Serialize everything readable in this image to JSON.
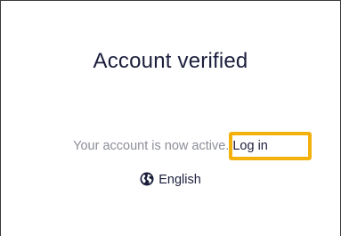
{
  "card": {
    "title": "Account verified",
    "message": "Your account is now active.",
    "login_link": "Log in",
    "language": {
      "label": "English",
      "icon": "globe-icon"
    }
  },
  "colors": {
    "title": "#1c1f3c",
    "message": "#8d8f99",
    "link": "#1c1f3c",
    "highlight": "#f2b10c",
    "border": "#3a3a3a"
  }
}
